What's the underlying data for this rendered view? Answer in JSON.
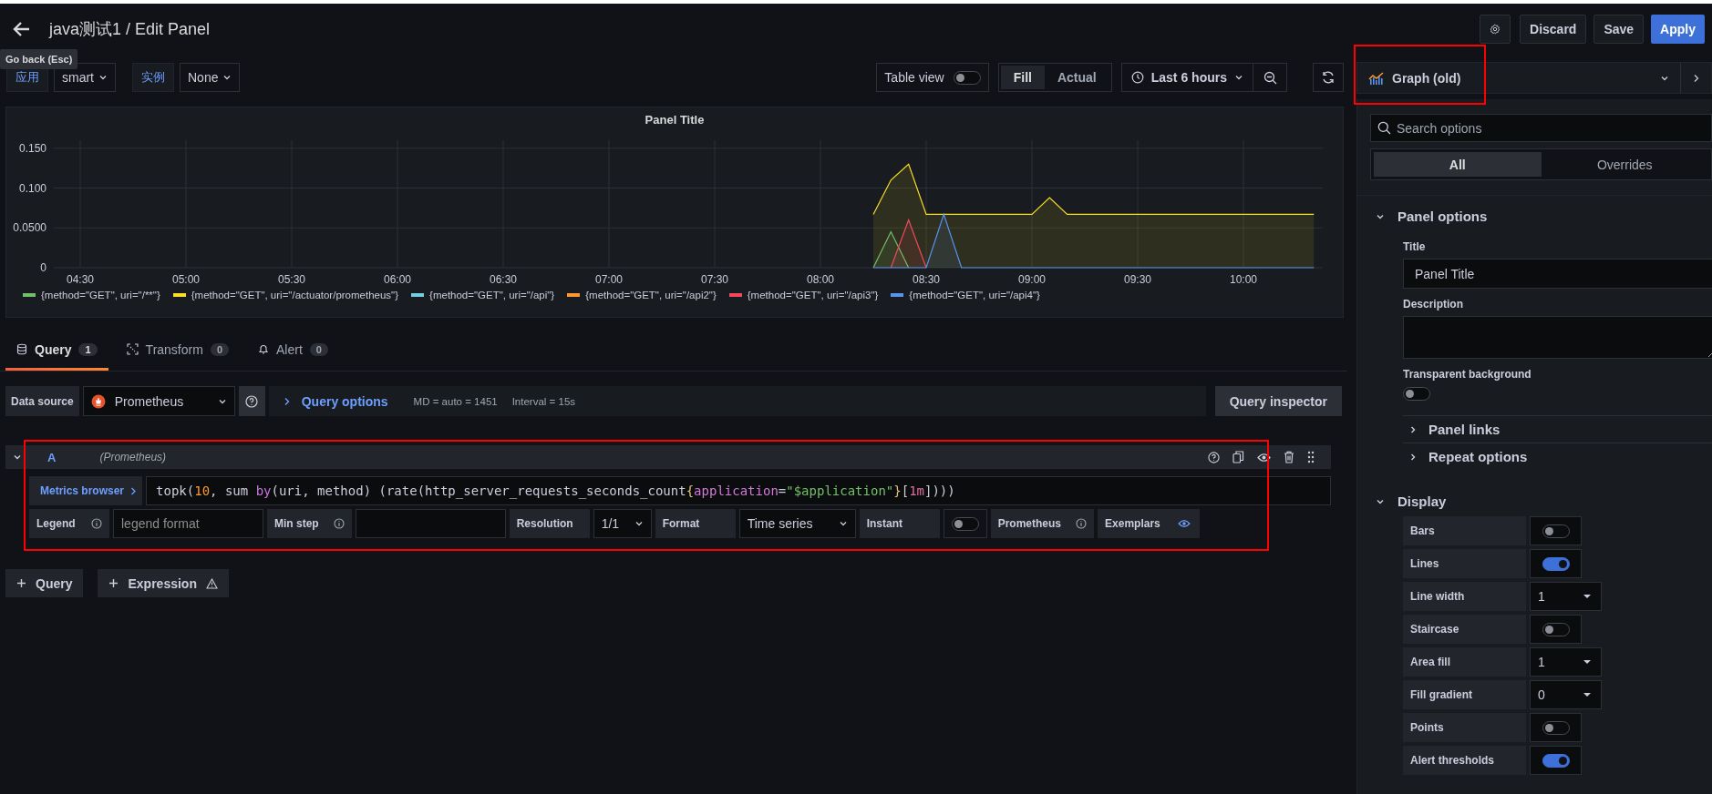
{
  "header": {
    "title": "java测试1 / Edit Panel",
    "back_tooltip": "Go back (Esc)",
    "buttons": [
      {
        "label": "Discard",
        "kind": "secondary"
      },
      {
        "label": "Save",
        "kind": "secondary"
      },
      {
        "label": "Apply",
        "kind": "primary"
      }
    ]
  },
  "variables": [
    {
      "label": "应用",
      "value": "smart"
    },
    {
      "label": "实例",
      "value": "None"
    }
  ],
  "toolbar": {
    "table_view": {
      "label": "Table view",
      "on": false
    },
    "size_modes": [
      {
        "label": "Fill",
        "selected": true
      },
      {
        "label": "Actual",
        "selected": false
      }
    ],
    "time_range": "Last 6 hours"
  },
  "panel": {
    "title": "Panel Title",
    "chart_data": {
      "type": "line",
      "grid": true,
      "ylim": [
        0,
        0.16
      ],
      "categories": [
        null,
        "04:30",
        null,
        null,
        null,
        null,
        null,
        "05:00",
        null,
        null,
        null,
        null,
        null,
        "05:30",
        null,
        null,
        null,
        null,
        null,
        "06:00",
        null,
        null,
        null,
        null,
        null,
        "06:30",
        null,
        null,
        null,
        null,
        null,
        "07:00",
        null,
        null,
        null,
        null,
        null,
        "07:30",
        null,
        null,
        null,
        null,
        null,
        "08:00",
        null,
        null,
        null,
        null,
        null,
        "08:30",
        null,
        null,
        null,
        null,
        null,
        "09:00",
        null,
        null,
        null,
        null,
        null,
        "09:30",
        null,
        null,
        null,
        null,
        null,
        "10:00",
        null,
        null,
        null,
        null
      ],
      "yticks": [
        {
          "value": 0,
          "label": "0"
        },
        {
          "value": 0.05,
          "label": "0.0500"
        },
        {
          "value": 0.1,
          "label": "0.100"
        },
        {
          "value": 0.15,
          "label": "0.150"
        }
      ],
      "series": [
        {
          "name": "{method=\"GET\", uri=\"/**\"}",
          "color": "#73bf69",
          "values": [
            null,
            null,
            null,
            null,
            null,
            null,
            null,
            null,
            null,
            null,
            null,
            null,
            null,
            null,
            null,
            null,
            null,
            null,
            null,
            null,
            null,
            null,
            null,
            null,
            null,
            null,
            null,
            null,
            null,
            null,
            null,
            null,
            null,
            null,
            null,
            null,
            null,
            null,
            null,
            null,
            null,
            null,
            null,
            null,
            null,
            null,
            0,
            0.045,
            0,
            null,
            null,
            null,
            null,
            null,
            null,
            null,
            null,
            null,
            null,
            null,
            null,
            null,
            null,
            null,
            null,
            null,
            null,
            null,
            null,
            null,
            null,
            null
          ]
        },
        {
          "name": "{method=\"GET\", uri=\"/actuator/prometheus\"}",
          "color": "#fade2a",
          "values": [
            null,
            null,
            null,
            null,
            null,
            null,
            null,
            null,
            null,
            null,
            null,
            null,
            null,
            null,
            null,
            null,
            null,
            null,
            null,
            null,
            null,
            null,
            null,
            null,
            null,
            null,
            null,
            null,
            null,
            null,
            null,
            null,
            null,
            null,
            null,
            null,
            null,
            null,
            null,
            null,
            null,
            null,
            null,
            null,
            null,
            null,
            0.067,
            0.11,
            0.13,
            0.067,
            0.067,
            0.067,
            0.067,
            0.067,
            0.067,
            0.067,
            0.088,
            0.067,
            0.067,
            0.067,
            0.067,
            0.067,
            0.067,
            0.067,
            0.067,
            0.067,
            0.067,
            0.067,
            0.067,
            0.067,
            0.067,
            0.067
          ]
        },
        {
          "name": "{method=\"GET\", uri=\"/api\"}",
          "color": "#6ed0e0",
          "values": [
            null,
            null,
            null,
            null,
            null,
            null,
            null,
            null,
            null,
            null,
            null,
            null,
            null,
            null,
            null,
            null,
            null,
            null,
            null,
            null,
            null,
            null,
            null,
            null,
            null,
            null,
            null,
            null,
            null,
            null,
            null,
            null,
            null,
            null,
            null,
            null,
            null,
            null,
            null,
            null,
            null,
            null,
            null,
            null,
            null,
            null,
            null,
            null,
            null,
            null,
            null,
            null,
            null,
            null,
            null,
            null,
            null,
            null,
            null,
            null,
            null,
            null,
            null,
            null,
            null,
            null,
            null,
            null,
            null,
            null,
            null,
            null
          ]
        },
        {
          "name": "{method=\"GET\", uri=\"/api2\"}",
          "color": "#ff9830",
          "values": [
            null,
            null,
            null,
            null,
            null,
            null,
            null,
            null,
            null,
            null,
            null,
            null,
            null,
            null,
            null,
            null,
            null,
            null,
            null,
            null,
            null,
            null,
            null,
            null,
            null,
            null,
            null,
            null,
            null,
            null,
            null,
            null,
            null,
            null,
            null,
            null,
            null,
            null,
            null,
            null,
            null,
            null,
            null,
            null,
            null,
            null,
            null,
            null,
            null,
            null,
            null,
            null,
            null,
            null,
            null,
            null,
            null,
            null,
            null,
            null,
            null,
            null,
            null,
            null,
            null,
            null,
            null,
            null,
            null,
            null,
            null,
            null
          ]
        },
        {
          "name": "{method=\"GET\", uri=\"/api3\"}",
          "color": "#f2495c",
          "values": [
            null,
            null,
            null,
            null,
            null,
            null,
            null,
            null,
            null,
            null,
            null,
            null,
            null,
            null,
            null,
            null,
            null,
            null,
            null,
            null,
            null,
            null,
            null,
            null,
            null,
            null,
            null,
            null,
            null,
            null,
            null,
            null,
            null,
            null,
            null,
            null,
            null,
            null,
            null,
            null,
            null,
            null,
            null,
            null,
            null,
            null,
            null,
            0,
            0.06,
            0,
            null,
            null,
            null,
            null,
            null,
            null,
            null,
            null,
            null,
            null,
            null,
            null,
            null,
            null,
            null,
            null,
            null,
            null,
            null,
            null,
            null,
            null
          ]
        },
        {
          "name": "{method=\"GET\", uri=\"/api4\"}",
          "color": "#5794f2",
          "values": [
            null,
            null,
            null,
            null,
            null,
            null,
            null,
            null,
            null,
            null,
            null,
            null,
            null,
            null,
            null,
            null,
            null,
            null,
            null,
            null,
            null,
            null,
            null,
            null,
            null,
            null,
            null,
            null,
            null,
            null,
            null,
            null,
            null,
            null,
            null,
            null,
            null,
            null,
            null,
            null,
            null,
            null,
            null,
            null,
            null,
            null,
            0,
            0,
            0,
            0,
            0.067,
            0,
            0,
            0,
            0,
            0,
            0,
            0,
            0,
            0,
            0,
            0,
            0,
            0,
            0,
            0,
            0,
            0,
            0,
            0,
            0,
            0
          ]
        }
      ]
    }
  },
  "editor_tabs": [
    {
      "label": "Query",
      "count": "1",
      "kind": "query",
      "selected": true
    },
    {
      "label": "Transform",
      "count": "0",
      "kind": "transform",
      "selected": false
    },
    {
      "label": "Alert",
      "count": "0",
      "kind": "alert",
      "selected": false
    }
  ],
  "data_source": {
    "label": "Data source",
    "value": "Prometheus",
    "query_options": "Query options",
    "md": "MD = auto = 1451",
    "interval": "Interval = 15s",
    "inspector": "Query inspector"
  },
  "query": {
    "highlighted": true,
    "ref": "A",
    "source": "(Prometheus)",
    "metrics_browser": "Metrics browser",
    "expression": [
      {
        "text": "topk(",
        "kind": "plain"
      },
      {
        "text": "10",
        "kind": "number"
      },
      {
        "text": ", sum ",
        "kind": "plain"
      },
      {
        "text": "by",
        "kind": "keyword"
      },
      {
        "text": "(uri, method) (rate(http_server_requests_seconds_count",
        "kind": "plain"
      },
      {
        "text": "{",
        "kind": "brace"
      },
      {
        "text": "application",
        "kind": "label"
      },
      {
        "text": "=",
        "kind": "plain"
      },
      {
        "text": "\"$application\"",
        "kind": "string"
      },
      {
        "text": "}",
        "kind": "brace"
      },
      {
        "text": "[",
        "kind": "plain"
      },
      {
        "text": "1m",
        "kind": "duration"
      },
      {
        "text": "]",
        "kind": "plain"
      },
      {
        "text": ")))",
        "kind": "plain"
      }
    ],
    "fields": [
      {
        "kind": "input",
        "label": "Legend",
        "info": true,
        "placeholder": "legend format"
      },
      {
        "kind": "input",
        "label": "Min step",
        "info": true
      },
      {
        "kind": "select",
        "label": "Resolution",
        "info": false,
        "value": "1/1"
      },
      {
        "kind": "select",
        "label": "Format",
        "info": false,
        "value": "Time series"
      },
      {
        "kind": "toggle",
        "label": "Instant",
        "info": false,
        "on": false
      },
      {
        "kind": "label",
        "label": "Prometheus",
        "info": true
      },
      {
        "kind": "eye",
        "label": "Exemplars",
        "info": false
      }
    ]
  },
  "add_buttons": [
    {
      "label": "Query",
      "warning": false
    },
    {
      "label": "Expression",
      "warning": true
    }
  ],
  "options": {
    "visualization": {
      "name": "Graph (old)",
      "highlighted": true
    },
    "search_placeholder": "Search options",
    "tabs": [
      {
        "label": "All",
        "selected": true
      },
      {
        "label": "Overrides",
        "selected": false
      }
    ],
    "panel_options": {
      "heading": "Panel options",
      "expanded": true,
      "title_label": "Title",
      "title_value": "Panel Title",
      "description_label": "Description",
      "transparent_label": "Transparent background",
      "transparent": false
    },
    "collapsed_sections": [
      {
        "heading": "Panel links",
        "expanded": false
      },
      {
        "heading": "Repeat options",
        "expanded": false
      }
    ],
    "display": {
      "heading": "Display",
      "expanded": true,
      "rows": [
        {
          "kind": "toggle",
          "label": "Bars",
          "on": false
        },
        {
          "kind": "toggle",
          "label": "Lines",
          "on": true
        },
        {
          "kind": "select",
          "label": "Line width",
          "value": "1"
        },
        {
          "kind": "toggle",
          "label": "Staircase",
          "on": false
        },
        {
          "kind": "select",
          "label": "Area fill",
          "value": "1"
        },
        {
          "kind": "select",
          "label": "Fill gradient",
          "value": "0"
        },
        {
          "kind": "toggle",
          "label": "Points",
          "on": false
        },
        {
          "kind": "toggle",
          "label": "Alert thresholds",
          "on": true
        }
      ]
    }
  }
}
